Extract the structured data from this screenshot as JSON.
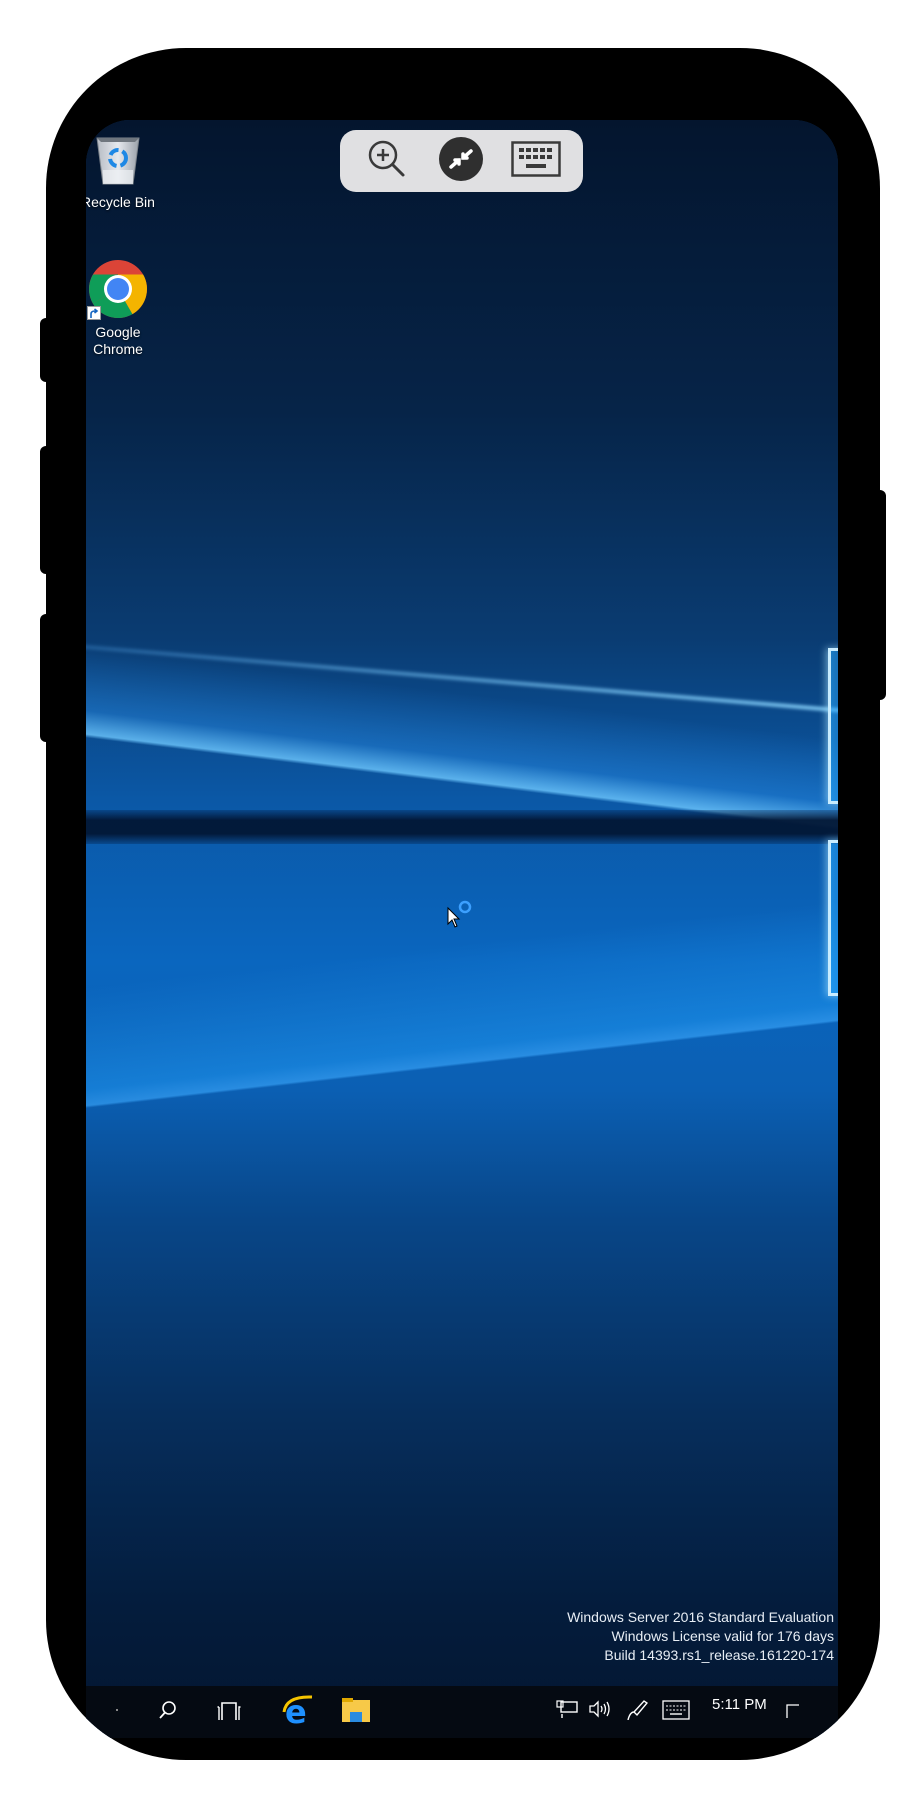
{
  "device": {
    "frame_color": "#000000",
    "background_color": "#ffffff"
  },
  "remote_toolbar": {
    "buttons": [
      {
        "name": "zoom-in",
        "icon": "zoom-in-icon"
      },
      {
        "name": "remote-desktop",
        "icon": "remote-desktop-icon"
      },
      {
        "name": "keyboard",
        "icon": "keyboard-icon"
      }
    ],
    "background": "#e0e0e2"
  },
  "desktop": {
    "icons": [
      {
        "label": "Recycle Bin",
        "icon": "recycle-bin-icon"
      },
      {
        "label": "Google\nChrome",
        "line1": "Google",
        "line2": "Chrome",
        "icon": "chrome-icon",
        "shortcut": true
      }
    ],
    "watermark": {
      "line1": "Windows Server 2016 Standard Evaluation",
      "line2": "Windows License valid for 176 days",
      "line3": "Build 14393.rs1_release.161220-174"
    }
  },
  "taskbar": {
    "pinned": [
      {
        "name": "start",
        "icon": "start-icon"
      },
      {
        "name": "search",
        "icon": "search-icon"
      },
      {
        "name": "task-view",
        "icon": "task-view-icon"
      },
      {
        "name": "internet-explorer",
        "icon": "internet-explorer-icon"
      },
      {
        "name": "file-explorer",
        "icon": "file-explorer-icon"
      }
    ],
    "tray": [
      {
        "name": "network",
        "icon": "network-icon"
      },
      {
        "name": "volume",
        "icon": "volume-icon"
      },
      {
        "name": "pen",
        "icon": "pen-icon"
      },
      {
        "name": "touch-keyboard",
        "icon": "keyboard-icon"
      }
    ],
    "clock": {
      "time": "5:11 PM"
    },
    "show_desktop": "show-desktop-icon"
  },
  "cursor": {
    "state": "busy"
  }
}
